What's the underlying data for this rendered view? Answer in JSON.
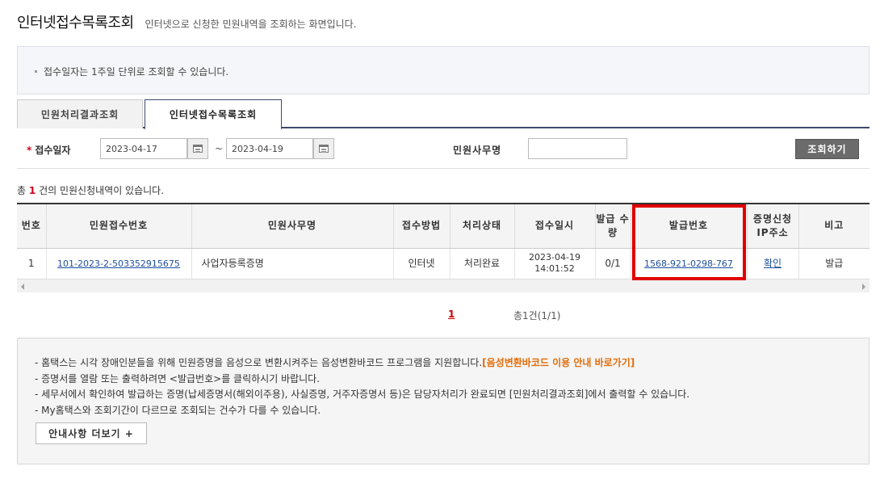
{
  "header": {
    "title": "인터넷접수목록조회",
    "subtitle": "인터넷으로 신청한 민원내역을 조회하는 화면입니다."
  },
  "notice": {
    "text": "접수일자는 1주일 단위로 조회할 수 있습니다."
  },
  "tabs": [
    {
      "label": "민원처리결과조회",
      "active": false
    },
    {
      "label": "인터넷접수목록조회",
      "active": true
    }
  ],
  "search": {
    "date_label": "접수일자",
    "required_mark": "*",
    "date_from": "2023-04-17",
    "date_to": "2023-04-19",
    "tilde": "~",
    "office_label": "민원사무명",
    "office_value": "",
    "button_label": "조회하기"
  },
  "result": {
    "prefix": "총",
    "count": "1",
    "suffix": "건의 민원신청내역이 있습니다."
  },
  "table": {
    "headers": [
      "번호",
      "민원접수번호",
      "민원사무명",
      "접수방법",
      "처리상태",
      "접수일시",
      "발급 수량",
      "발급번호",
      "증명신청 IP주소",
      "비고"
    ],
    "rows": [
      {
        "no": "1",
        "receipt_no": "101-2023-2-503352915675",
        "office_name": "사업자등록증명",
        "method": "인터넷",
        "status": "처리완료",
        "date": "2023-04-19",
        "time": "14:01:52",
        "quantity": "0/1",
        "issue_no": "1568-921-0298-767",
        "ip": "확인",
        "remark": "발급"
      }
    ]
  },
  "pagination": {
    "current": "1",
    "summary": "총1건(1/1)"
  },
  "guide": {
    "line1": "- 홈택스는 시각 장애인분들을 위해 민원증명을 음성으로 변환시켜주는 음성변환바코드 프로그램을 지원합니다.",
    "line1_link": "[음성변환바코드 이용 안내 바로가기]",
    "line2": "- 증명서를 열람 또는 출력하려면 <발급번호>를 클릭하시기 바랍니다.",
    "line3": "- 세무서에서 확인하여 발급하는 증명(납세증명서(해외이주용), 사실증명, 거주자증명서 등)은 담당자처리가 완료되면 [민원처리결과조회]에서 출력할 수 있습니다.",
    "line4": "- My홈택스와 조회기간이 다르므로 조회되는 건수가 다를 수 있습니다.",
    "more_button": "안내사항 더보기 +"
  },
  "colors": {
    "highlight": "#e00000",
    "link": "#1d4f9c",
    "accent_orange": "#e36c09",
    "required": "#d0021b"
  }
}
